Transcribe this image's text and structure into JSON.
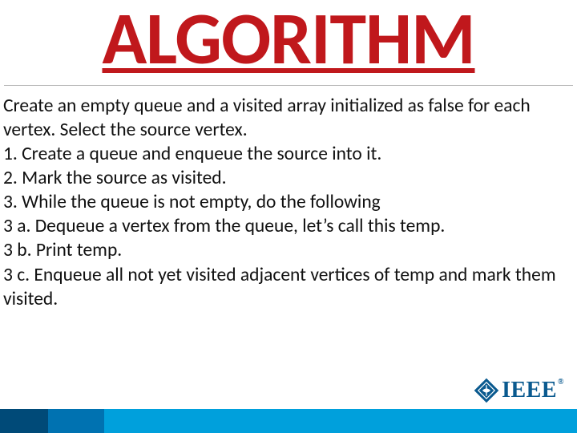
{
  "title": "ALGORITHM",
  "body": {
    "intro": "Create an empty queue and a visited array initialized as false for each vertex. Select the source vertex.",
    "step1": "1. Create a queue and enqueue the source into it.",
    "step2": "2. Mark the source as visited.",
    "step3": "3. While the queue is not empty, do the following",
    "step3a": " 3 a. Dequeue a vertex from the queue, let’s call this temp.",
    "step3b": " 3 b. Print temp.",
    "step3c": " 3 c. Enqueue all not yet visited adjacent vertices of temp and mark them visited."
  },
  "logo": {
    "text": "IEEE",
    "reg": "®"
  }
}
